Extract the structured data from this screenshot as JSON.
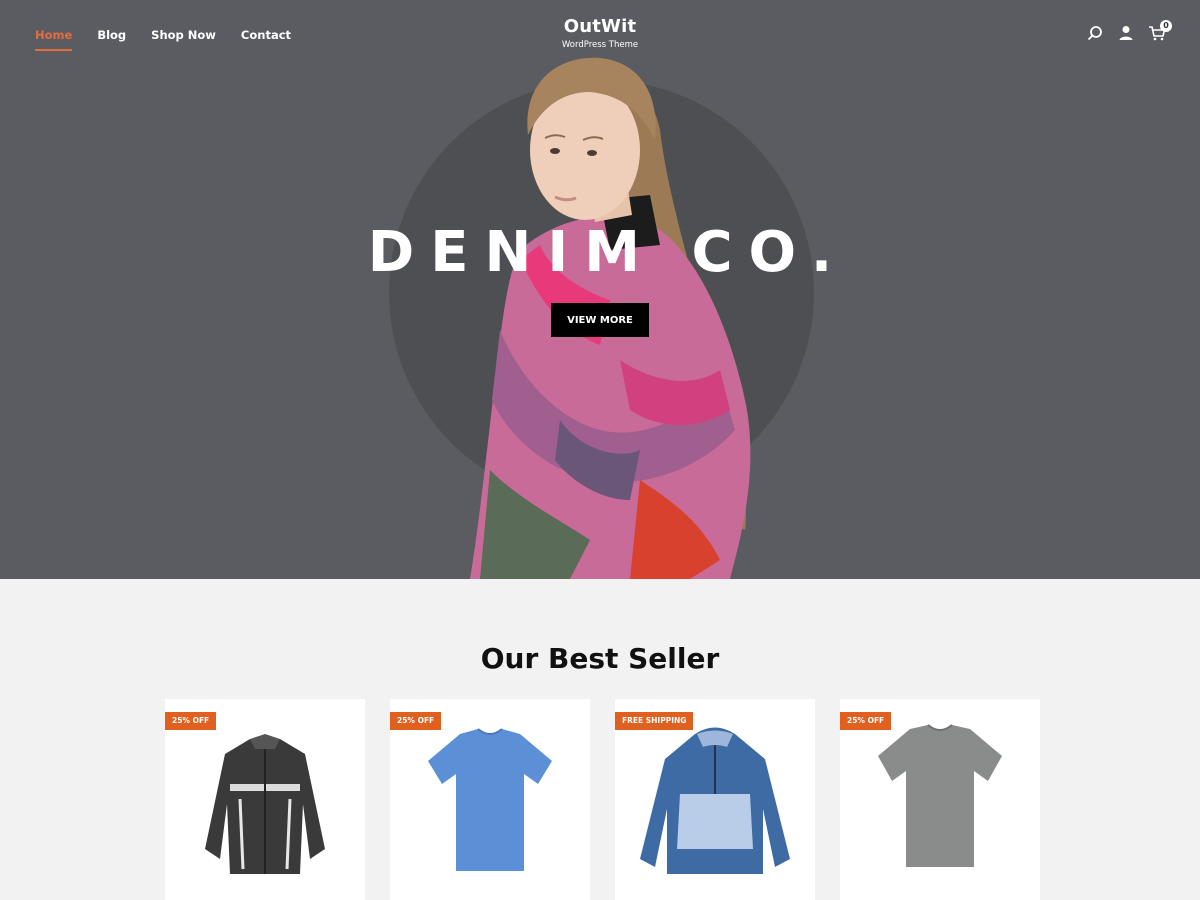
{
  "nav": {
    "items": [
      {
        "label": "Home",
        "active": true
      },
      {
        "label": "Blog",
        "active": false
      },
      {
        "label": "Shop Now",
        "active": false
      },
      {
        "label": "Contact",
        "active": false
      }
    ],
    "active_color": "#e56c3e"
  },
  "brand": {
    "title": "OutWit",
    "subtitle": "WordPress Theme"
  },
  "header_icons": {
    "search": "search-icon",
    "account": "user-icon",
    "cart": "cart-icon",
    "cart_count": "0"
  },
  "hero": {
    "title": "DENIM CO.",
    "button_label": "VIEW MORE",
    "background": "#5a5c61"
  },
  "best_seller": {
    "title": "Our Best Seller",
    "products": [
      {
        "badge": "25% OFF",
        "image": "black-white-jacket"
      },
      {
        "badge": "25% OFF",
        "image": "blue-tshirt"
      },
      {
        "badge": "FREE SHIPPING",
        "image": "blue-anorak"
      },
      {
        "badge": "25% OFF",
        "image": "grey-tshirt"
      }
    ],
    "badge_color": "#e0601f"
  }
}
